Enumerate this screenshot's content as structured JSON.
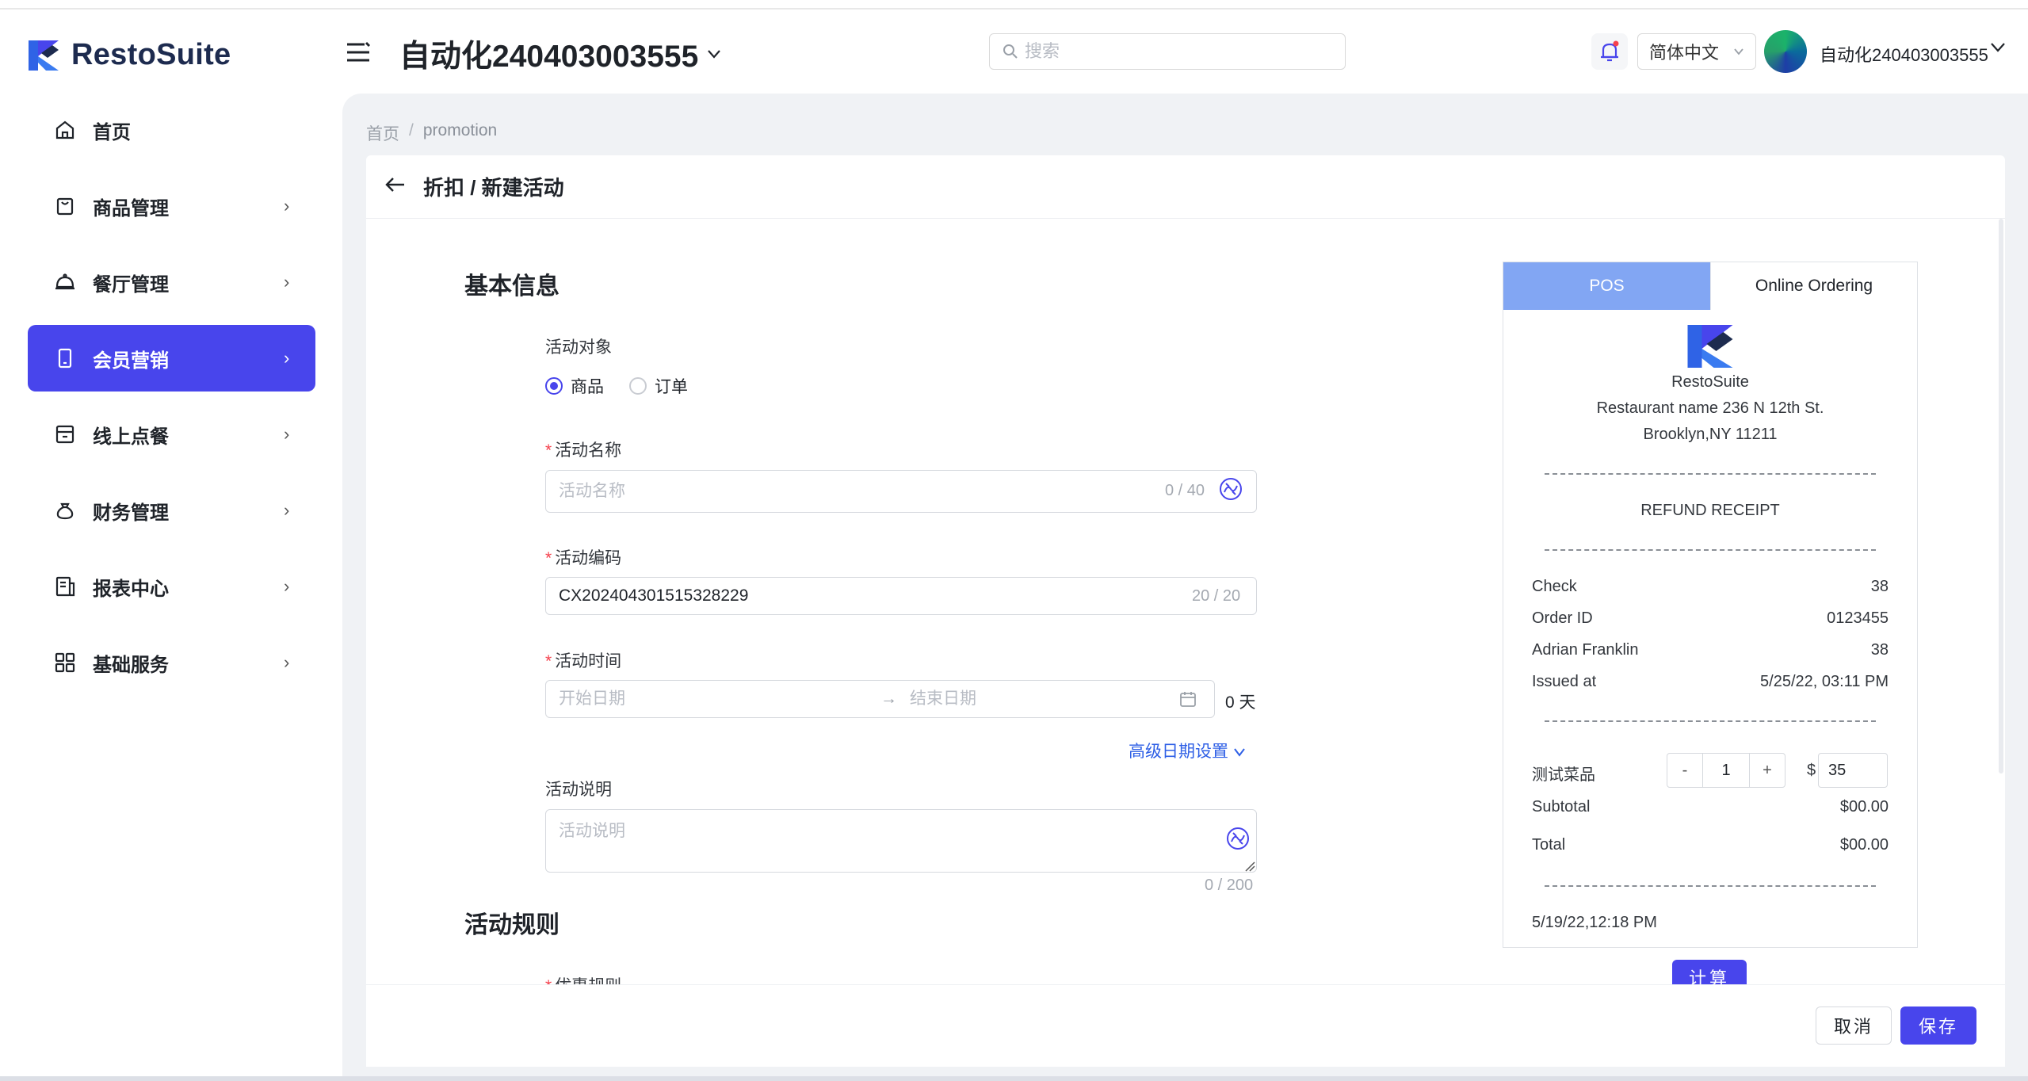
{
  "app": {
    "brand": "RestoSuite"
  },
  "sidebar": {
    "items": [
      {
        "label": "首页",
        "icon": "home-icon",
        "has_arrow": false
      },
      {
        "label": "商品管理",
        "icon": "bag-icon",
        "has_arrow": true
      },
      {
        "label": "餐厅管理",
        "icon": "cloche-icon",
        "has_arrow": true
      },
      {
        "label": "会员营销",
        "icon": "phone-icon",
        "has_arrow": true,
        "active": true
      },
      {
        "label": "线上点餐",
        "icon": "store-icon",
        "has_arrow": true
      },
      {
        "label": "财务管理",
        "icon": "money-bag-icon",
        "has_arrow": true
      },
      {
        "label": "报表中心",
        "icon": "report-icon",
        "has_arrow": true
      },
      {
        "label": "基础服务",
        "icon": "grid-icon",
        "has_arrow": true
      }
    ]
  },
  "header": {
    "store_name": "自动化240403003555",
    "search_placeholder": "搜索",
    "language": "简体中文",
    "user_name": "自动化240403003555"
  },
  "breadcrumb": {
    "home": "首页",
    "sep": "/",
    "current": "promotion"
  },
  "page": {
    "title": "折扣 / 新建活动"
  },
  "form": {
    "basic_info_title": "基本信息",
    "target_label": "活动对象",
    "target_options": [
      "商品",
      "订单"
    ],
    "target_selected": "商品",
    "name_label": "活动名称",
    "name_placeholder": "活动名称",
    "name_counter": "0 / 40",
    "code_label": "活动编码",
    "code_value": "CX202404301515328229",
    "code_counter": "20 / 20",
    "time_label": "活动时间",
    "start_placeholder": "开始日期",
    "range_arrow": "→",
    "end_placeholder": "结束日期",
    "days_text": "0 天",
    "advanced_date": "高级日期设置",
    "desc_label": "活动说明",
    "desc_placeholder": "活动说明",
    "desc_counter": "0 / 200",
    "rules_title": "活动规则",
    "rules_first_label": "优惠规则"
  },
  "receipt": {
    "tabs": [
      "POS",
      "Online Ordering"
    ],
    "brand": "RestoSuite",
    "address1": "Restaurant name 236 N 12th St.",
    "address2": "Brooklyn,NY 11211",
    "receipt_title": "REFUND RECEIPT",
    "rows": [
      {
        "label": "Check",
        "value": "38"
      },
      {
        "label": "Order ID",
        "value": "0123455"
      },
      {
        "label": "Adrian Franklin",
        "value": "38"
      },
      {
        "label": "Issued at",
        "value": "5/25/22, 03:11 PM"
      }
    ],
    "item_name": "测试菜品",
    "qty": "1",
    "minus": "-",
    "plus": "+",
    "currency": "$",
    "price": "35",
    "subtotal_label": "Subtotal",
    "subtotal_value": "$00.00",
    "total_label": "Total",
    "total_value": "$00.00",
    "footer_time": "5/19/22,12:18 PM",
    "calc_button": "计算"
  },
  "footer": {
    "cancel": "取消",
    "save": "保存"
  },
  "colors": {
    "accent": "#4845ec",
    "tab_active": "#82a6f3",
    "required": "#f5414d",
    "link": "#2e5fe6"
  }
}
